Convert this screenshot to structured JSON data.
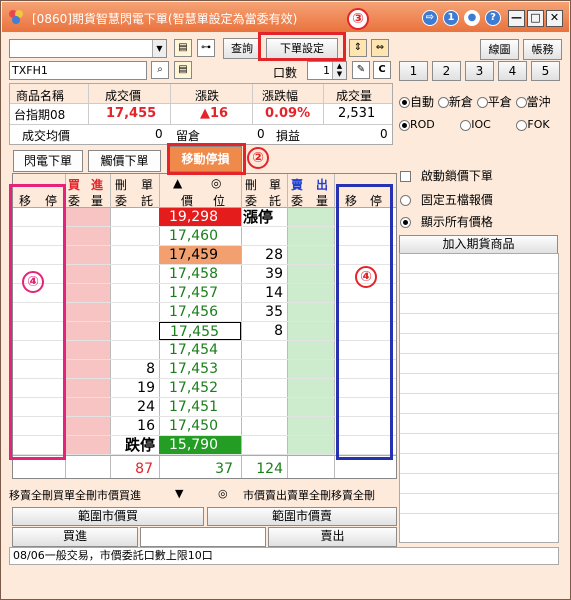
{
  "window": {
    "title": "[0860]期貨智慧閃電下單(智慧單設定為當委有效)",
    "accent": "#e9733d"
  },
  "toolbar": {
    "account_value": "",
    "symbol_value": "TXFH1",
    "query_label": "查詢",
    "order_setting_label": "下單設定",
    "qty_label": "口數",
    "qty_value": "1",
    "chart_label": "線圖",
    "account_label": "帳務",
    "c_label": "C",
    "number_buttons": [
      "1",
      "2",
      "3",
      "4",
      "5"
    ]
  },
  "quote": {
    "headers": [
      "商品名稱",
      "成交價",
      "漲跌",
      "漲跌幅",
      "成交量"
    ],
    "name": "台指期08",
    "price": "17,455",
    "change": "▲16",
    "change_pct": "0.09%",
    "volume": "2,531",
    "avg_label": "成交均價",
    "avg_value": "0",
    "hold_label": "留倉",
    "hold_value": "0",
    "pl_label": "損益",
    "pl_value": "0"
  },
  "options": {
    "mode": [
      {
        "label": "自動",
        "on": true
      },
      {
        "label": "新倉",
        "on": false
      },
      {
        "label": "平倉",
        "on": false
      },
      {
        "label": "當沖",
        "on": false
      }
    ],
    "tif": [
      {
        "label": "ROD",
        "on": true
      },
      {
        "label": "IOC",
        "on": false
      },
      {
        "label": "FOK",
        "on": false
      }
    ],
    "start_limit_label": "啟動鎖價下單",
    "fixed5_label": "固定五檔報價",
    "show_all_label": "顯示所有價格",
    "add_product_label": "加入期貨商品"
  },
  "tabs": [
    {
      "label": "閃電下單",
      "active": false
    },
    {
      "label": "觸價下單",
      "active": false
    },
    {
      "label": "移動停損",
      "active": true
    }
  ],
  "ladder": {
    "head_top": {
      "buy": "買",
      "in": "進",
      "del1": "刪",
      "order1": "單",
      "up": "▲",
      "mid": "◎",
      "del2": "刪",
      "order2": "單",
      "sell": "賣",
      "out": "出"
    },
    "head_bottom": {
      "move_l": "移",
      "stop_l": "停",
      "entrust_b": "委",
      "qty_b": "量",
      "del_b": "刪",
      "entrust_b2": "委",
      "tuo_b": "託",
      "price": "價",
      "pos": "位",
      "del_s": "刪",
      "entrust_s": "委",
      "tuo_s": "託",
      "entrust_s2": "委",
      "qty_s": "量",
      "move_r": "移",
      "stop_r": "停"
    },
    "rows": [
      {
        "price": "19,298",
        "bid": "",
        "ask": "漲停",
        "style": "limitup"
      },
      {
        "price": "17,460",
        "bid": "",
        "ask": "",
        "style": ""
      },
      {
        "price": "17,459",
        "bid": "",
        "ask": "28",
        "style": "orange"
      },
      {
        "price": "17,458",
        "bid": "",
        "ask": "39",
        "style": ""
      },
      {
        "price": "17,457",
        "bid": "",
        "ask": "14",
        "style": ""
      },
      {
        "price": "17,456",
        "bid": "",
        "ask": "35",
        "style": ""
      },
      {
        "price": "17,455",
        "bid": "",
        "ask": "8",
        "style": "boxed"
      },
      {
        "price": "17,454",
        "bid": "",
        "ask": "",
        "style": ""
      },
      {
        "price": "17,453",
        "bid": "8",
        "ask": "",
        "style": ""
      },
      {
        "price": "17,452",
        "bid": "19",
        "ask": "",
        "style": ""
      },
      {
        "price": "17,451",
        "bid": "24",
        "ask": "",
        "style": ""
      },
      {
        "price": "17,450",
        "bid": "16",
        "ask": "",
        "style": ""
      },
      {
        "price": "15,790",
        "bid": "跌停",
        "ask": "",
        "style": "limitdown"
      }
    ],
    "total_bid": "87",
    "total_mid": "37",
    "total_ask": "124"
  },
  "bottom": {
    "left_cancel": "移賣全刪買單全刪市價買進",
    "mid_down": "▼",
    "mid_circle": "◎",
    "right_cancel": "市價賣出賣單全刪移賣全刪",
    "range_buy": "範圍市價買",
    "range_sell": "範圍市價賣",
    "buy": "買進",
    "sell": "賣出",
    "status": "08/06一般交易，市價委託口數上限10口"
  },
  "annotations": [
    "②",
    "③",
    "④",
    "④"
  ]
}
